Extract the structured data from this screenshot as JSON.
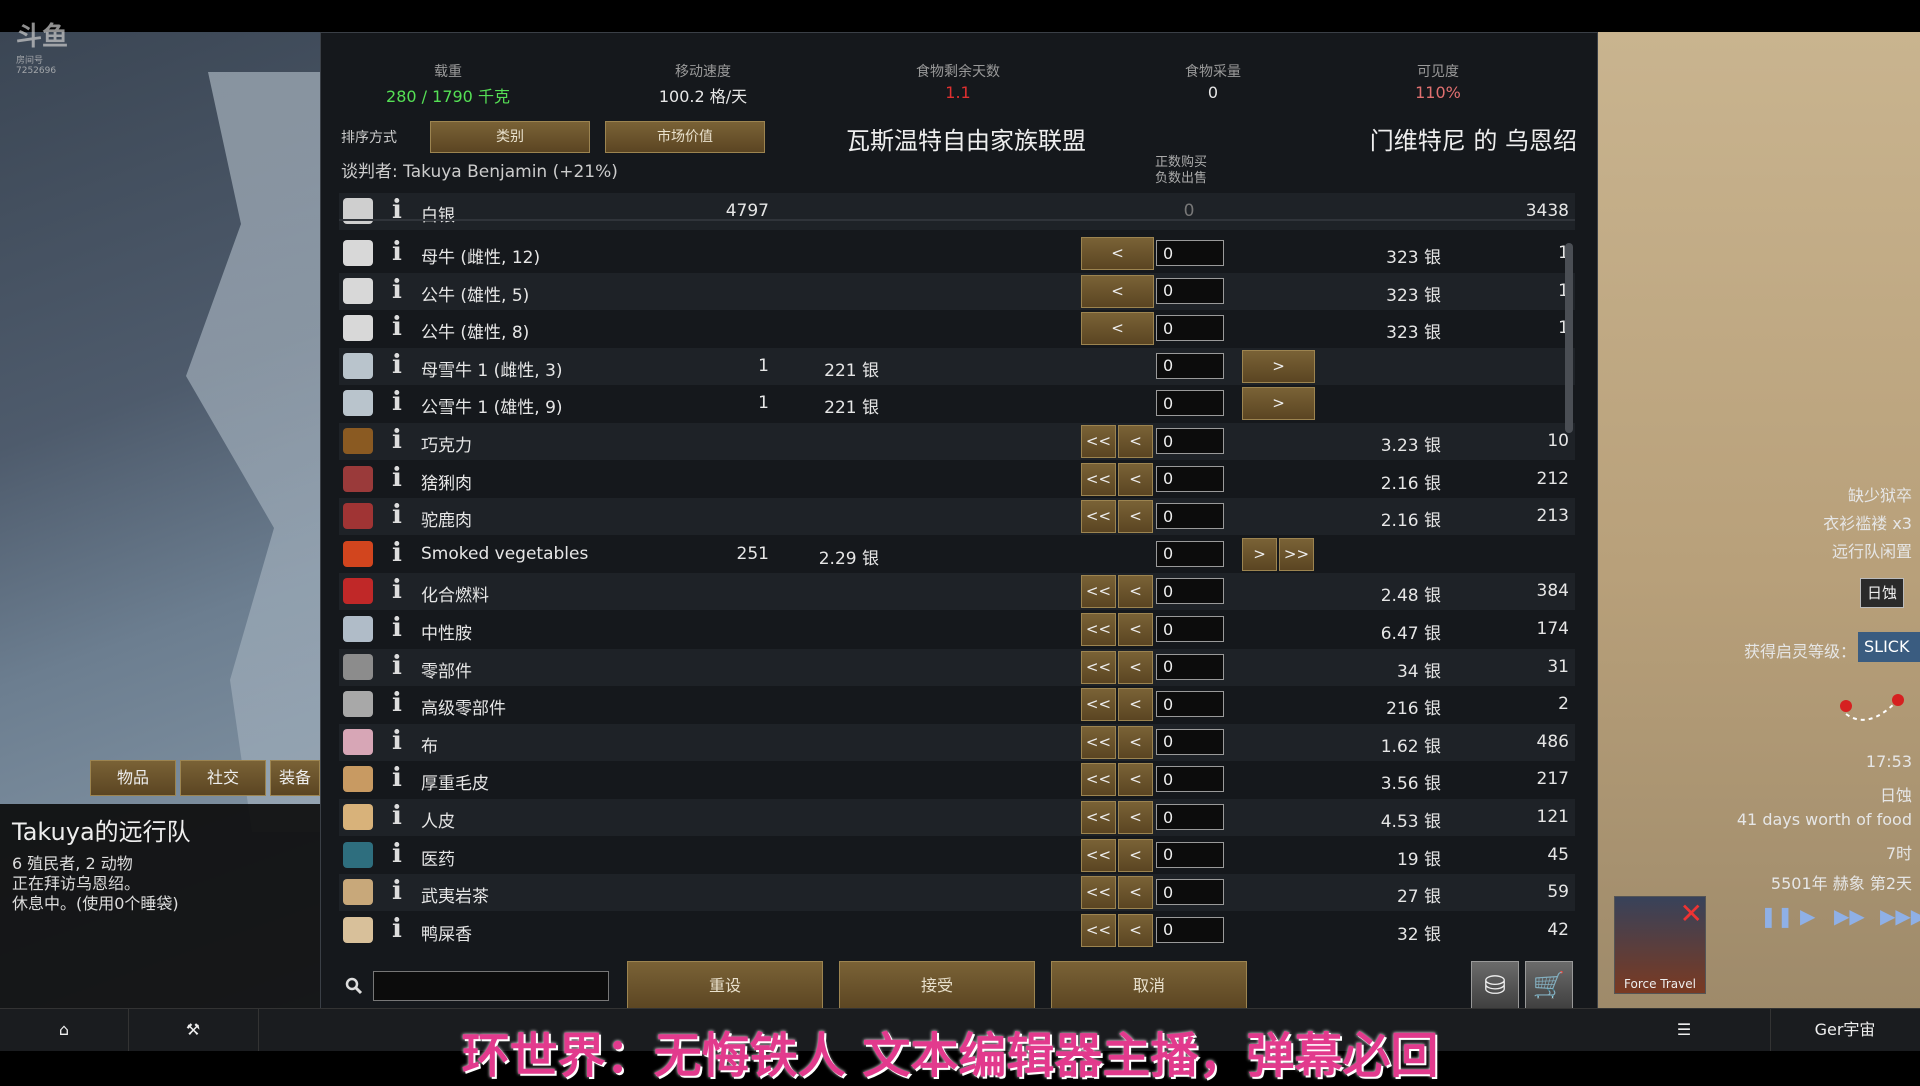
{
  "watermark": {
    "logo": "斗鱼",
    "sub1": "房间号",
    "sub2": "7252696"
  },
  "stats": [
    {
      "label": "载重",
      "value": "280 / 1790 千克",
      "color": "#55e055"
    },
    {
      "label": "移动速度",
      "value": "100.2 格/天",
      "color": "#e6e6e6"
    },
    {
      "label": "食物剩余天数",
      "value": "1.1",
      "color": "#e03030"
    },
    {
      "label": "食物采量",
      "value": "0",
      "color": "#e6e6e6"
    },
    {
      "label": "可见度",
      "value": "110%",
      "color": "#e07070"
    }
  ],
  "sort": {
    "label": "排序方式",
    "btn1": "类别",
    "btn2": "市场价值"
  },
  "factions": {
    "left": "瓦斯温特自由家族联盟",
    "right": "门维特尼 的 乌恩绍"
  },
  "negotiator": "谈判者: Takuya Benjamin (+21%)",
  "hint": {
    "line1": "正数购买",
    "line2": "负数出售"
  },
  "silver": {
    "name": "白银",
    "left": "4797",
    "qty": "0",
    "right": "3438"
  },
  "rows": [
    {
      "name": "母牛 (雌性, 12)",
      "lcnt": "",
      "lprice": "",
      "left": "<",
      "qty": "0",
      "right": "",
      "rprice": "323 银",
      "rcnt": "1",
      "icon": "cow-icon",
      "color": "#d8d8d8"
    },
    {
      "name": "公牛 (雄性, 5)",
      "lcnt": "",
      "lprice": "",
      "left": "<",
      "qty": "0",
      "right": "",
      "rprice": "323 银",
      "rcnt": "1",
      "icon": "cow-icon",
      "color": "#d8d8d8"
    },
    {
      "name": "公牛 (雄性, 8)",
      "lcnt": "",
      "lprice": "",
      "left": "<",
      "qty": "0",
      "right": "",
      "rprice": "323 银",
      "rcnt": "1",
      "icon": "cow-icon",
      "color": "#d8d8d8"
    },
    {
      "name": "母雪牛 1 (雌性, 3)",
      "lcnt": "1",
      "lprice": "221 银",
      "left": "",
      "qty": "0",
      "right": ">",
      "rprice": "",
      "rcnt": "",
      "icon": "yak-icon",
      "color": "#b9c4cc"
    },
    {
      "name": "公雪牛 1 (雄性, 9)",
      "lcnt": "1",
      "lprice": "221 银",
      "left": "",
      "qty": "0",
      "right": ">",
      "rprice": "",
      "rcnt": "",
      "icon": "yak-icon",
      "color": "#b9c4cc"
    },
    {
      "name": "巧克力",
      "lcnt": "",
      "lprice": "",
      "left": "<<",
      "qty": "0",
      "right": "",
      "rprice": "3.23 银",
      "rcnt": "10",
      "icon": "chocolate-icon",
      "color": "#8a5a22"
    },
    {
      "name": "猞猁肉",
      "lcnt": "",
      "lprice": "",
      "left": "<<",
      "qty": "0",
      "right": "",
      "rprice": "2.16 银",
      "rcnt": "212",
      "icon": "meat-icon",
      "color": "#9a3a3a"
    },
    {
      "name": "驼鹿肉",
      "lcnt": "",
      "lprice": "",
      "left": "<<",
      "qty": "0",
      "right": "",
      "rprice": "2.16 银",
      "rcnt": "213",
      "icon": "meat-icon",
      "color": "#a03434"
    },
    {
      "name": "Smoked vegetables",
      "lcnt": "251",
      "lprice": "2.29 银",
      "left": "",
      "qty": "0",
      "right": ">>",
      "rprice": "",
      "rcnt": "",
      "icon": "vegetables-icon",
      "color": "#d2451e"
    },
    {
      "name": "化合燃料",
      "lcnt": "",
      "lprice": "",
      "left": "<<",
      "qty": "0",
      "right": "",
      "rprice": "2.48 银",
      "rcnt": "384",
      "icon": "fuel-icon",
      "color": "#c02828"
    },
    {
      "name": "中性胺",
      "lcnt": "",
      "lprice": "",
      "left": "<<",
      "qty": "0",
      "right": "",
      "rprice": "6.47 银",
      "rcnt": "174",
      "icon": "neutroamine-icon",
      "color": "#b0bcc8"
    },
    {
      "name": "零部件",
      "lcnt": "",
      "lprice": "",
      "left": "<<",
      "qty": "0",
      "right": "",
      "rprice": "34 银",
      "rcnt": "31",
      "icon": "component-icon",
      "color": "#8c8c8c"
    },
    {
      "name": "高级零部件",
      "lcnt": "",
      "lprice": "",
      "left": "<<",
      "qty": "0",
      "right": "",
      "rprice": "216 银",
      "rcnt": "2",
      "icon": "adv-component-icon",
      "color": "#a8a8a8"
    },
    {
      "name": "布",
      "lcnt": "",
      "lprice": "",
      "left": "<<",
      "qty": "0",
      "right": "",
      "rprice": "1.62 银",
      "rcnt": "486",
      "icon": "cloth-icon",
      "color": "#d7a6b6"
    },
    {
      "name": "厚重毛皮",
      "lcnt": "",
      "lprice": "",
      "left": "<<",
      "qty": "0",
      "right": "",
      "rprice": "3.56 银",
      "rcnt": "217",
      "icon": "fur-icon",
      "color": "#c89a62"
    },
    {
      "name": "人皮",
      "lcnt": "",
      "lprice": "",
      "left": "<<",
      "qty": "0",
      "right": "",
      "rprice": "4.53 银",
      "rcnt": "121",
      "icon": "leather-icon",
      "color": "#d8b27a"
    },
    {
      "name": "医药",
      "lcnt": "",
      "lprice": "",
      "left": "<<",
      "qty": "0",
      "right": "",
      "rprice": "19 银",
      "rcnt": "45",
      "icon": "medicine-icon",
      "color": "#2e6e7e"
    },
    {
      "name": "武夷岩茶",
      "lcnt": "",
      "lprice": "",
      "left": "<<",
      "qty": "0",
      "right": "",
      "rprice": "27 银",
      "rcnt": "59",
      "icon": "tea-icon",
      "color": "#c8a87a"
    },
    {
      "name": "鸭屎香",
      "lcnt": "",
      "lprice": "",
      "left": "<<",
      "qty": "0",
      "right": "",
      "rprice": "32 银",
      "rcnt": "42",
      "icon": "tea-icon",
      "color": "#d8c09a"
    }
  ],
  "bottom": {
    "reset": "重设",
    "accept": "接受",
    "cancel": "取消"
  },
  "left_tabs": {
    "items": "物品",
    "social": "社交",
    "gear": "装备"
  },
  "caravan": {
    "title": "Takuya的远行队",
    "line1": "6 殖民者, 2 动物",
    "line2": "正在拜访乌恩绍。",
    "line3": "休息中。(使用0个睡袋)"
  },
  "right_info": {
    "alert1": "缺少狱卒",
    "alert2": "衣衫褴褛 x3",
    "alert3": "远行队闲置",
    "eclipse_btn": "日蚀",
    "inspiration": "获得启灵等级：",
    "slick": "SLICK",
    "time": "17:53",
    "weather": "日蚀",
    "food": "41 days worth of food",
    "hour": "7时",
    "date": "5501年 赫象 第2天",
    "force_travel": "Force Travel"
  },
  "bottom_bar": {
    "world": "Ger宇宙"
  },
  "caption": "环世界：无悔铁人 文本编辑器主播，弹幕必回"
}
